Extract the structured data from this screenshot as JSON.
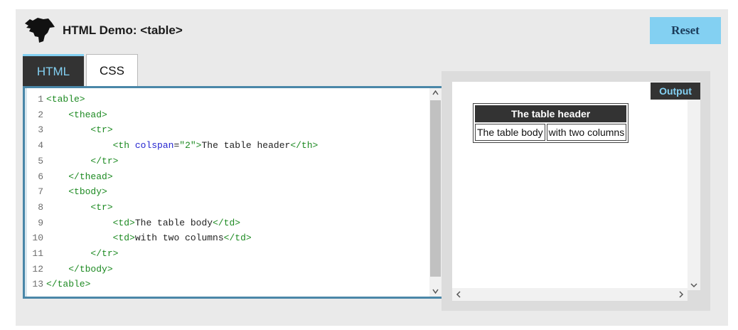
{
  "header": {
    "title": "HTML Demo: <table>",
    "reset_label": "Reset"
  },
  "tabs": [
    {
      "label": "HTML",
      "active": true
    },
    {
      "label": "CSS",
      "active": false
    }
  ],
  "editor": {
    "lines": [
      {
        "n": "1",
        "indent": "",
        "parts": [
          {
            "t": "<table>",
            "c": "tag"
          }
        ]
      },
      {
        "n": "2",
        "indent": "    ",
        "parts": [
          {
            "t": "<thead>",
            "c": "tag"
          }
        ]
      },
      {
        "n": "3",
        "indent": "        ",
        "parts": [
          {
            "t": "<tr>",
            "c": "tag"
          }
        ]
      },
      {
        "n": "4",
        "indent": "            ",
        "parts": [
          {
            "t": "<th ",
            "c": "tag"
          },
          {
            "t": "colspan",
            "c": "attr"
          },
          {
            "t": "=",
            "c": "txt"
          },
          {
            "t": "\"2\"",
            "c": "val"
          },
          {
            "t": ">",
            "c": "tag"
          },
          {
            "t": "The table header",
            "c": "txt"
          },
          {
            "t": "</th>",
            "c": "tag"
          }
        ]
      },
      {
        "n": "5",
        "indent": "        ",
        "parts": [
          {
            "t": "</tr>",
            "c": "tag"
          }
        ]
      },
      {
        "n": "6",
        "indent": "    ",
        "parts": [
          {
            "t": "</thead>",
            "c": "tag"
          }
        ]
      },
      {
        "n": "7",
        "indent": "    ",
        "parts": [
          {
            "t": "<tbody>",
            "c": "tag"
          }
        ]
      },
      {
        "n": "8",
        "indent": "        ",
        "parts": [
          {
            "t": "<tr>",
            "c": "tag"
          }
        ]
      },
      {
        "n": "9",
        "indent": "            ",
        "parts": [
          {
            "t": "<td>",
            "c": "tag"
          },
          {
            "t": "The table body",
            "c": "txt"
          },
          {
            "t": "</td>",
            "c": "tag"
          }
        ]
      },
      {
        "n": "10",
        "indent": "            ",
        "parts": [
          {
            "t": "<td>",
            "c": "tag"
          },
          {
            "t": "with two columns",
            "c": "txt"
          },
          {
            "t": "</td>",
            "c": "tag"
          }
        ]
      },
      {
        "n": "11",
        "indent": "        ",
        "parts": [
          {
            "t": "</tr>",
            "c": "tag"
          }
        ]
      },
      {
        "n": "12",
        "indent": "    ",
        "parts": [
          {
            "t": "</tbody>",
            "c": "tag"
          }
        ]
      },
      {
        "n": "13",
        "indent": "",
        "parts": [
          {
            "t": "</table>",
            "c": "tag"
          }
        ]
      }
    ]
  },
  "output": {
    "label": "Output",
    "table_header": "The table header",
    "table_cells": [
      "The table body",
      "with two columns"
    ]
  },
  "colors": {
    "accent": "#83d0f2",
    "editor_border": "#4a87a8",
    "tag": "#1d8a22",
    "attr": "#2525d0",
    "dark": "#333333"
  },
  "icons": [
    "logo-icon",
    "scroll-up-icon",
    "scroll-down-icon",
    "scroll-left-icon",
    "scroll-right-icon"
  ]
}
